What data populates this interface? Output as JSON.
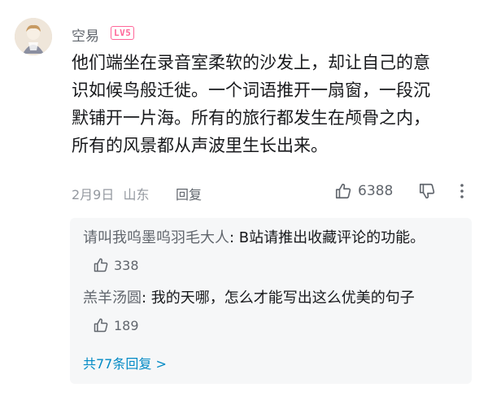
{
  "comment": {
    "username": "空易",
    "level_badge": "LV5",
    "content": "他们端坐在录音室柔软的沙发上，却让自己的意\n识如候鸟般迁徙。一个词语推开一扇窗，一段沉\n默铺开一片海。所有的旅行都发生在颅骨之内，\n所有的风景都从声波里生长出来。",
    "date": "2月9日",
    "location": "山东",
    "reply_label": "回复",
    "like_count": "6388",
    "icons": {
      "like": "thumbs-up-icon",
      "dislike": "thumbs-down-icon",
      "more": "more-vertical-icon"
    }
  },
  "replies": [
    {
      "name": "请叫我呜墨呜羽毛大人",
      "separator": ":",
      "text": " B站请推出收藏评论的功能。",
      "like_count": "338"
    },
    {
      "name": "羔羊汤圆",
      "separator": ":",
      "text": " 我的天哪，怎么才能写出这么优美的句子",
      "like_count": "189"
    }
  ],
  "total_replies": "共77条回复 >",
  "colors": {
    "accent_pink": "#ff6699",
    "link_blue": "#008ac5",
    "text_gray": "#61666d",
    "sub_bg": "#f6f7f8"
  }
}
